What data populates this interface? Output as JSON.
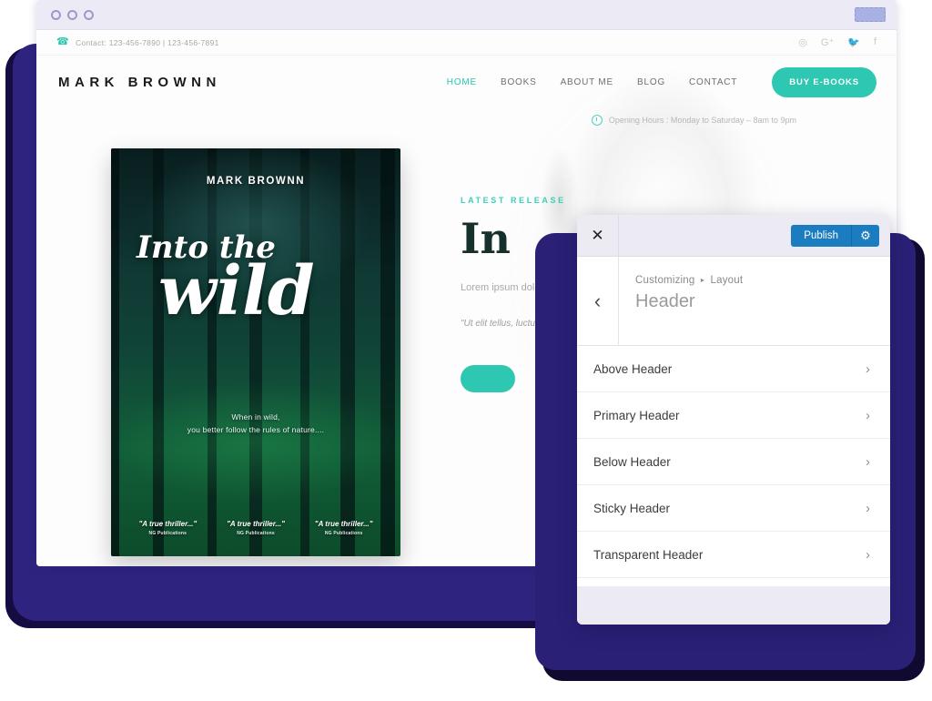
{
  "browser": {
    "dots": [
      "dot-1",
      "dot-2",
      "dot-3"
    ],
    "tab_placeholder": ""
  },
  "site": {
    "topbar": {
      "phone_icon": "phone-icon",
      "contact": "Contact: 123-456-7890 | 123-456-7891",
      "socials": [
        {
          "name": "instagram-icon",
          "glyph": "◎"
        },
        {
          "name": "google-plus-icon",
          "glyph": "G⁺"
        },
        {
          "name": "twitter-icon",
          "glyph": "🐦"
        },
        {
          "name": "facebook-icon",
          "glyph": "f"
        }
      ]
    },
    "brand": "MARK BROWNN",
    "menu": [
      {
        "label": "HOME",
        "active": true
      },
      {
        "label": "BOOKS",
        "active": false
      },
      {
        "label": "ABOUT ME",
        "active": false
      },
      {
        "label": "BLOG",
        "active": false
      },
      {
        "label": "CONTACT",
        "active": false
      }
    ],
    "cta_label": "BUY E-BOOKS",
    "hours": "Opening Hours : Monday to Saturday – 8am to 9pm",
    "book": {
      "author": "MARK BROWNN",
      "title_line1": "Into the",
      "title_line2": "wild",
      "tagline_line1": "When in wild,",
      "tagline_line2": "you better follow the rules of nature....",
      "quotes": [
        {
          "text": "\"A true thriller...\"",
          "publisher": "NG Publications"
        },
        {
          "text": "\"A true thriller...\"",
          "publisher": "NG Publications"
        },
        {
          "text": "\"A true thriller...\"",
          "publisher": "NG Publications"
        }
      ]
    },
    "hero": {
      "eyebrow": "LATEST RELEASE",
      "heading": "In",
      "paragraph": "Lorem ipsum dolor commodo ligula e penatibus et mag",
      "quote": "\"Ut elit tellus, luctum",
      "button_label": ""
    }
  },
  "customizer": {
    "close_label": "✕",
    "publish_label": "Publish",
    "gear_icon": "gear-icon",
    "back_icon": "‹",
    "breadcrumb_root": "Customizing",
    "breadcrumb_separator": "▸",
    "breadcrumb_section": "Layout",
    "title": "Header",
    "items": [
      {
        "label": "Above Header",
        "chevron": "›"
      },
      {
        "label": "Primary Header",
        "chevron": "›"
      },
      {
        "label": "Below Header",
        "chevron": "›"
      },
      {
        "label": "Sticky Header",
        "chevron": "›"
      },
      {
        "label": "Transparent Header",
        "chevron": "›"
      }
    ]
  },
  "colors": {
    "accent_teal": "#2ec8b2",
    "publish_blue": "#1c7cc0",
    "shadow_indigo": "#2a2076",
    "shadow_navy": "#100a30",
    "panel_chrome": "#eceaf3"
  }
}
